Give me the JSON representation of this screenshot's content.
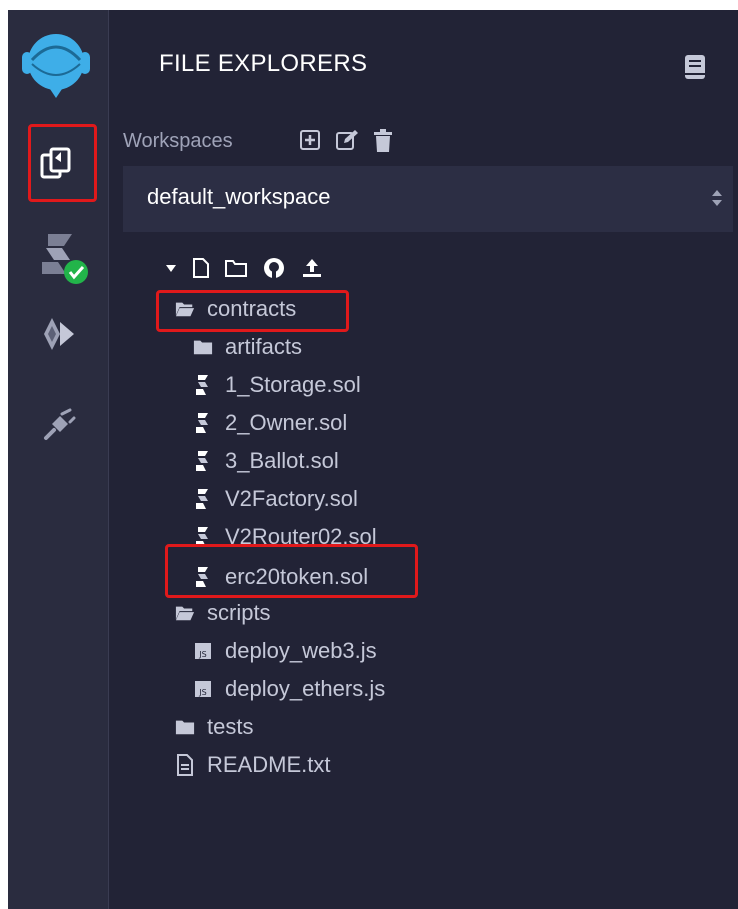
{
  "panel": {
    "title": "FILE EXPLORERS",
    "workspaces_label": "Workspaces",
    "workspace_selected": "default_workspace"
  },
  "tree": {
    "contracts": "contracts",
    "artifacts": "artifacts",
    "files_contracts": [
      "1_Storage.sol",
      "2_Owner.sol",
      "3_Ballot.sol",
      "V2Factory.sol",
      "V2Router02.sol",
      "erc20token.sol"
    ],
    "scripts": "scripts",
    "files_scripts": [
      "deploy_web3.js",
      "deploy_ethers.js"
    ],
    "tests": "tests",
    "readme": "README.txt"
  },
  "icons": {
    "sidebar": [
      "remix-logo-icon",
      "file-explorer-icon",
      "solidity-compiler-icon",
      "deploy-run-icon",
      "plugin-manager-icon"
    ],
    "workspace_actions": [
      "create-workspace-icon",
      "rename-workspace-icon",
      "delete-workspace-icon"
    ],
    "tree_actions": [
      "new-file-icon",
      "new-folder-icon",
      "github-icon",
      "upload-icon"
    ]
  },
  "colors": {
    "background": "#222336",
    "sidebar": "#2a2c3f",
    "highlight": "#e0191b",
    "success": "#22b44a",
    "logo": "#3eaee8"
  }
}
